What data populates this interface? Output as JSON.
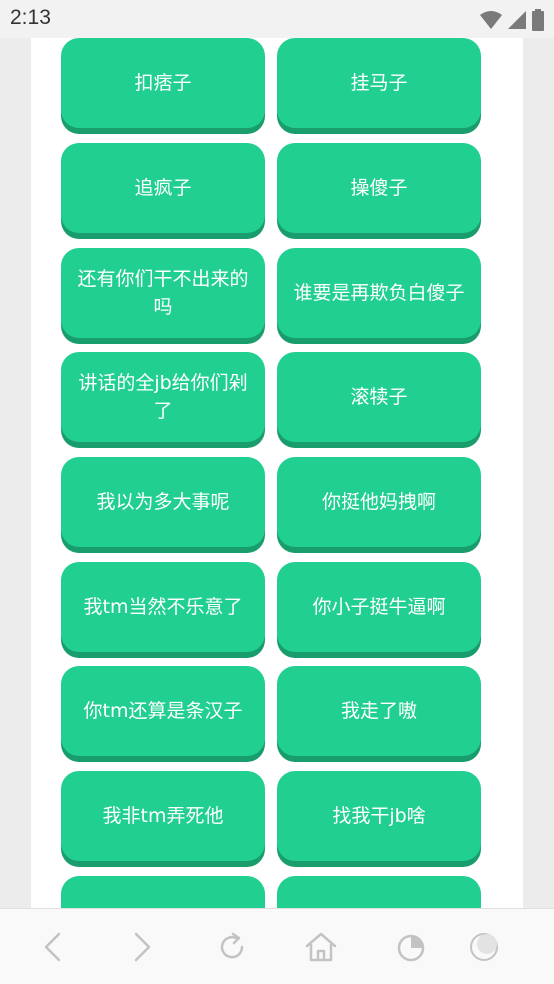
{
  "status": {
    "time": "2:13",
    "icons": [
      "wifi-icon",
      "signal-icon",
      "battery-icon"
    ]
  },
  "buttons": [
    {
      "label": "扣痞子"
    },
    {
      "label": "挂马子"
    },
    {
      "label": "追疯子"
    },
    {
      "label": "操傻子"
    },
    {
      "label": "还有你们干不出来的吗"
    },
    {
      "label": "谁要是再欺负白傻子"
    },
    {
      "label": "讲话的全jb给你们剁了"
    },
    {
      "label": "滚犊子"
    },
    {
      "label": "我以为多大事呢"
    },
    {
      "label": "你挺他妈拽啊"
    },
    {
      "label": "我tm当然不乐意了"
    },
    {
      "label": "你小子挺牛逼啊"
    },
    {
      "label": "你tm还算是条汉子"
    },
    {
      "label": "我走了嗷"
    },
    {
      "label": "我非tm弄死他"
    },
    {
      "label": "找我干jb啥"
    },
    {
      "label": ""
    },
    {
      "label": ""
    }
  ],
  "colors": {
    "button": "#21d091",
    "button_shadow": "#1a9d6c",
    "icon": "#c3c3c3"
  },
  "nav": [
    "back-icon",
    "forward-icon",
    "refresh-icon",
    "home-icon",
    "tabs-icon",
    "menu-icon"
  ]
}
